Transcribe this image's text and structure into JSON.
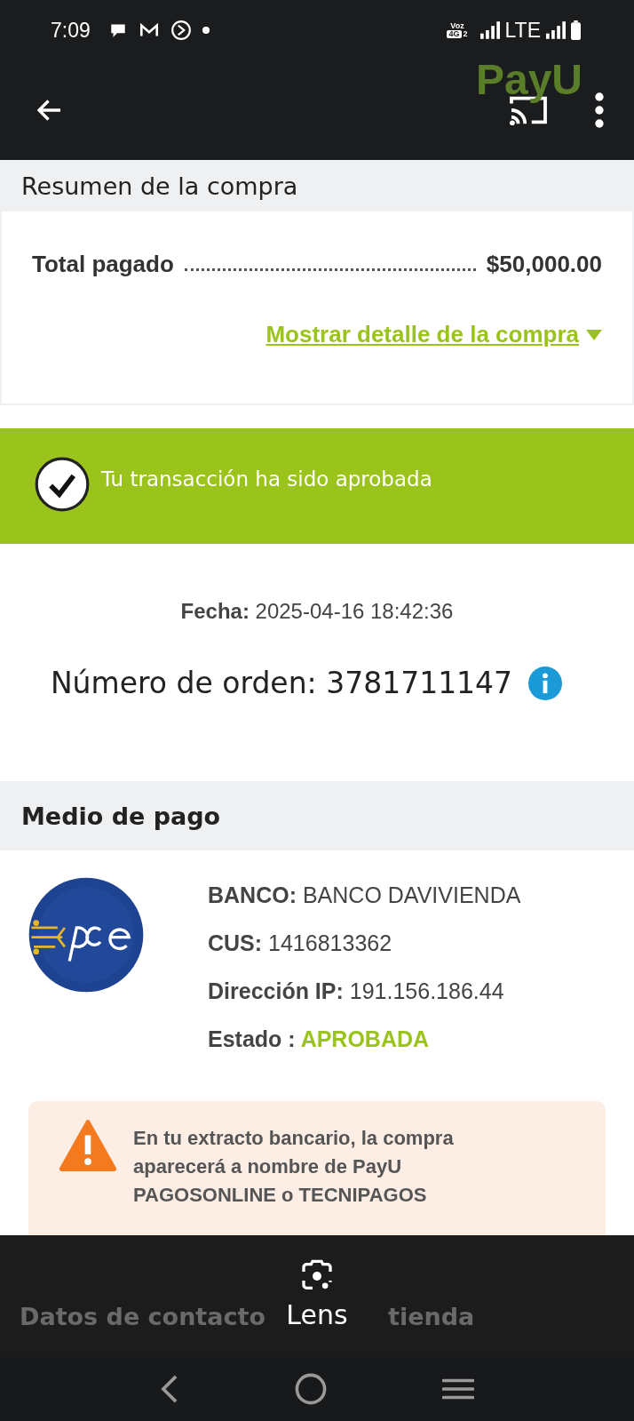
{
  "status_bar": {
    "time": "7:09",
    "network_badge_top": "Voz",
    "network_badge_bottom": "4G",
    "sim": "2",
    "network": "LTE"
  },
  "app_bar": {
    "logo": "PayU"
  },
  "summary": {
    "title": "Resumen de la compra",
    "total_label": "Total pagado",
    "total_value": "$50,000.00",
    "detail_link": "Mostrar detalle de la compra"
  },
  "banner": {
    "message": "Tu transacción ha sido aprobada",
    "approved": true
  },
  "order": {
    "date_label": "Fecha:",
    "date_value": "2025-04-16  18:42:36",
    "number_label": "Número de orden:",
    "number_value": "3781711147"
  },
  "payment": {
    "title": "Medio de pago",
    "fields": [
      {
        "label": "BANCO:",
        "value": "BANCO DAVIVIENDA",
        "kind": "plain"
      },
      {
        "label": "CUS:",
        "value": "1416813362",
        "kind": "plain"
      },
      {
        "label": "Dirección IP:",
        "value": "191.156.186.44",
        "kind": "plain"
      },
      {
        "label": "Estado :",
        "value": "APROBADA",
        "kind": "status"
      }
    ]
  },
  "warning": {
    "text": "En tu extracto bancario, la compra aparecerá a nombre de PayU PAGOSONLINE o TECNIPAGOS"
  },
  "contact": {
    "title_start": "Datos de contacto",
    "title_end": "tienda"
  },
  "lens": {
    "label": "Lens"
  }
}
